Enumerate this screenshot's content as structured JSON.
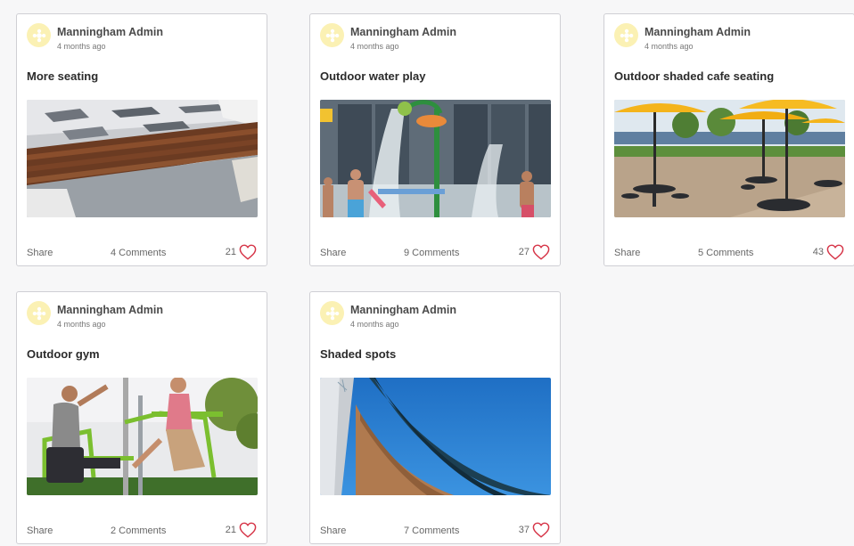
{
  "colors": {
    "page_background": "#f7f7f8",
    "card_border": "#cfcfd4",
    "avatar_background": "#fbf1b4",
    "heart": "#d63447"
  },
  "posts": [
    {
      "author": "Manningham Admin",
      "time": "4 months ago",
      "title": "More seating",
      "share_label": "Share",
      "comments_label": "4 Comments",
      "likes": "21",
      "image": "wooden-bench-on-paving"
    },
    {
      "author": "Manningham Admin",
      "time": "4 months ago",
      "title": "Outdoor water play",
      "share_label": "Share",
      "comments_label": "9 Comments",
      "likes": "27",
      "image": "children-in-water-fountains"
    },
    {
      "author": "Manningham Admin",
      "time": "4 months ago",
      "title": "Outdoor shaded cafe seating",
      "share_label": "Share",
      "comments_label": "5 Comments",
      "likes": "43",
      "image": "tables-under-yellow-umbrellas"
    },
    {
      "author": "Manningham Admin",
      "time": "4 months ago",
      "title": "Outdoor gym",
      "share_label": "Share",
      "comments_label": "2 Comments",
      "likes": "21",
      "image": "people-on-outdoor-gym-equipment"
    },
    {
      "author": "Manningham Admin",
      "time": "4 months ago",
      "title": "Shaded spots",
      "share_label": "Share",
      "comments_label": "7 Comments",
      "likes": "37",
      "image": "shade-sails-against-blue-sky"
    }
  ]
}
